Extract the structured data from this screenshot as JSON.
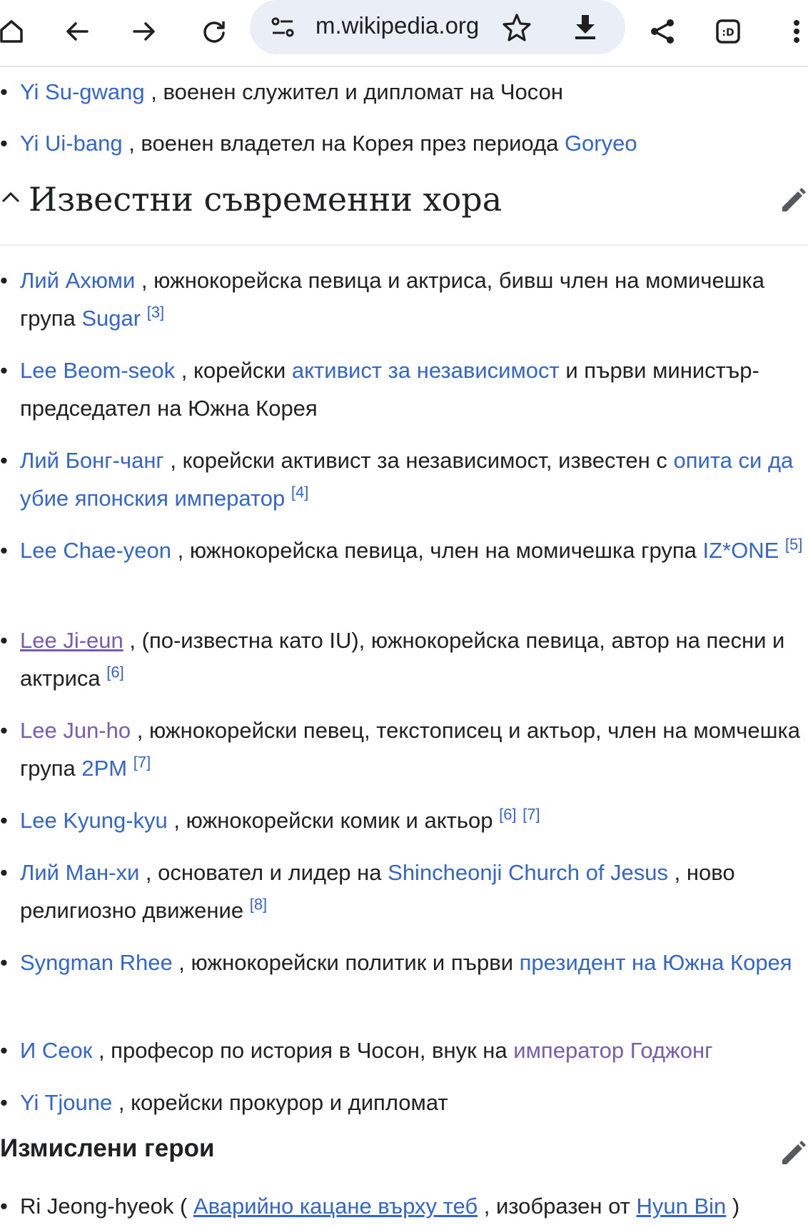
{
  "browser": {
    "url": "m.wikipedia.org"
  },
  "top_items": [
    {
      "link": "Yi Su-gwang",
      "text": " , военен служител и дипломат на Чосон"
    },
    {
      "link": "Yi Ui-bang",
      "text": " , военен владетел на Корея през периода ",
      "link2": "Goryeo"
    }
  ],
  "section_title": "Известни съвременни хора",
  "people": [
    {
      "l1": "Лий Ахюми",
      "t1": " , южнокорейска певица и актриса, бивш член на момичешка група ",
      "l2": "Sugar",
      "t2": " ",
      "ref": "[3]"
    },
    {
      "l1": "Lee Beom-seok",
      "t1": " , корейски ",
      "l2": "активист за независимост",
      "t2": " и първи министър-председател на Южна Корея"
    },
    {
      "l1": "Лий Бонг-чанг",
      "t1": " , корейски активист за независимост, известен с ",
      "l2": "опита си да убие японския император",
      "t2": " ",
      "ref": "[4]"
    },
    {
      "l1": "Lee Chae-yeon",
      "t1": " , южнокорейска певица, член на момичешка група ",
      "l2": "IZ*ONE",
      "t2": " ",
      "ref": "[5]"
    },
    {
      "l1": "Lee Ji-eun",
      "t1": " , (по-известна като IU), южнокорейска певица, автор на песни и актриса ",
      "ref": "[6]"
    },
    {
      "l1": "Lee Jun-ho",
      "t1": " , южнокорейски певец, текстописец и актьор, член на момчешка група ",
      "l2": "2PM",
      "t2": " ",
      "ref": "[7]"
    },
    {
      "l1": "Lee Kyung-kyu",
      "t1": " , южнокорейски комик и актьор ",
      "ref": "[6]",
      "ref2": "[7]"
    },
    {
      "l1": "Лий Ман-хи",
      "t1": " , основател и лидер на ",
      "l2": "Shincheonji Church of Jesus",
      "t2": " , ново религиозно движение ",
      "ref": "[8]"
    },
    {
      "l1": "Syngman Rhee",
      "t1": " , южнокорейски политик и първи ",
      "l2": "президент на Южна Корея"
    },
    {
      "l1": "И Сеок",
      "t1": " , професор по история в Чосон, внук на ",
      "l2": "император Годжонг"
    },
    {
      "l1": "Yi Tjoune",
      "t1": " , корейски прокурор и дипломат"
    }
  ],
  "section3_title": "Измислени герои",
  "fictional": [
    {
      "t0": "Ri Jeong-hyeok ( ",
      "l1": "Аварийно кацане върху теб",
      "t1": " , изобразен от ",
      "l2": "Hyun Bin",
      "t2": " )"
    }
  ],
  "colors": {
    "link": "#3366cc",
    "visited": "#795cb2",
    "text": "#202122"
  }
}
